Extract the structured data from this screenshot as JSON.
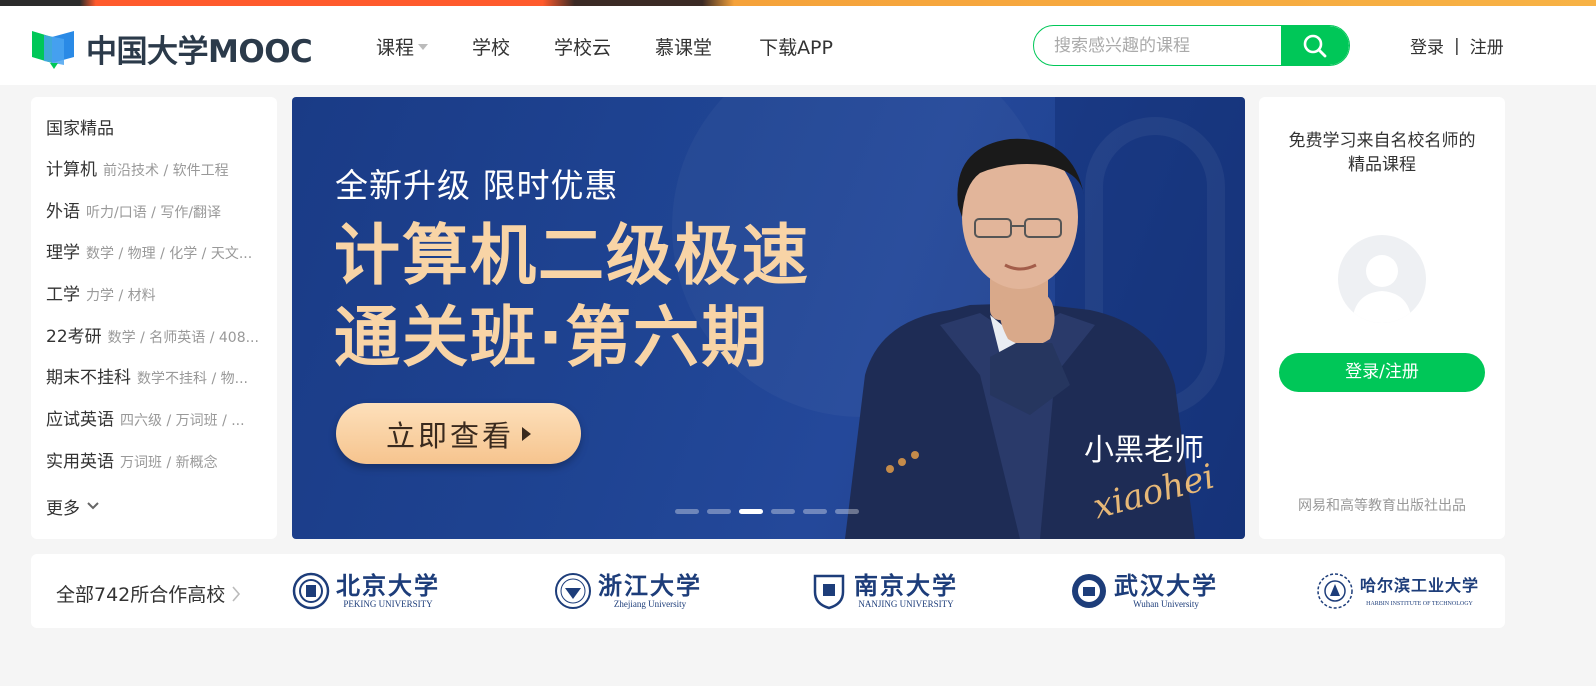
{
  "header": {
    "logo_text": "中国大学MOOC",
    "nav": [
      {
        "label": "课程",
        "has_dropdown": true
      },
      {
        "label": "学校"
      },
      {
        "label": "学校云"
      },
      {
        "label": "慕课堂"
      },
      {
        "label": "下载APP"
      }
    ],
    "search": {
      "placeholder": "搜索感兴趣的课程",
      "icon": "search-icon"
    },
    "login_label": "登录",
    "separator": "|",
    "register_label": "注册"
  },
  "categories": {
    "title": "国家精品",
    "items": [
      {
        "name": "计算机",
        "sub": "前沿技术 / 软件工程"
      },
      {
        "name": "外语",
        "sub": "听力/口语 / 写作/翻译"
      },
      {
        "name": "理学",
        "sub": "数学 / 物理 / 化学 / 天文..."
      },
      {
        "name": "工学",
        "sub": "力学 / 材料"
      },
      {
        "name": "22考研",
        "sub": "数学 / 名师英语 / 408..."
      },
      {
        "name": "期末不挂科",
        "sub": "数学不挂科 / 物..."
      },
      {
        "name": "应试英语",
        "sub": "四六级 / 万词班 / ..."
      },
      {
        "name": "实用英语",
        "sub": "万词班 / 新概念"
      }
    ],
    "more_label": "更多"
  },
  "banner": {
    "kicker": "全新升级 限时优惠",
    "title_line1": "计算机二级极速",
    "title_line2": "通关班·第六期",
    "cta_label": "立即查看",
    "teacher_name": "小黑老师",
    "teacher_signature": "xiaohei",
    "slides_total": 6,
    "active_slide": 3
  },
  "login_card": {
    "intro": "免费学习来自名校名师的精品课程",
    "button_label": "登录/注册",
    "footer": "网易和高等教育出版社出品"
  },
  "universities": {
    "all_label": "全部742所合作高校",
    "items": [
      {
        "cn": "北京大学",
        "en": "PEKING UNIVERSITY"
      },
      {
        "cn": "浙江大学",
        "en": "Zhejiang University"
      },
      {
        "cn": "南京大学",
        "en": "NANJING UNIVERSITY"
      },
      {
        "cn": "武汉大学",
        "en": "Wuhan University"
      },
      {
        "cn": "哈尔滨工业大学",
        "en": "HARBIN INSTITUTE OF TECHNOLOGY"
      }
    ]
  },
  "colors": {
    "brand_green": "#00c758",
    "banner_blue": "#1f4493",
    "banner_gold": "#f8d4a6",
    "university_blue": "#1d3d7a"
  }
}
